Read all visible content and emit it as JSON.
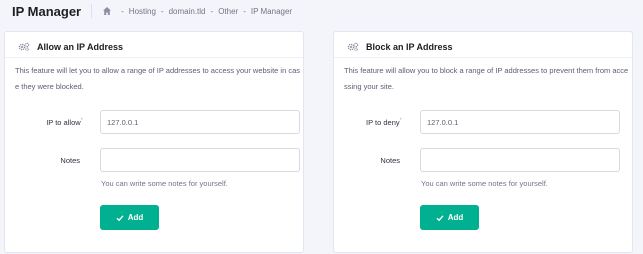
{
  "header": {
    "title": "IP Manager",
    "breadcrumb": [
      "Hosting",
      "domain.tld",
      "Other",
      "IP Manager"
    ]
  },
  "allow_card": {
    "title": "Allow an IP Address",
    "description": "This feature will let you to allow a range of IP addresses to access your website in case they were blocked.",
    "ip_label": "IP to allow",
    "ip_value": "127.0.0.1",
    "notes_label": "Notes",
    "notes_value": "",
    "notes_help": "You can write some notes for yourself.",
    "button_label": "Add"
  },
  "block_card": {
    "title": "Block an IP Address",
    "description": "This feature will allow you to block a range of IP addresses to prevent them from accessing your site.",
    "ip_label": "IP to deny",
    "ip_value": "127.0.0.1",
    "notes_label": "Notes",
    "notes_value": "",
    "notes_help": "You can write some notes for yourself.",
    "button_label": "Add"
  },
  "colors": {
    "accent": "#00b090",
    "title": "#1d1e20",
    "background": "#f4f5fb"
  },
  "icons": {
    "home": "home-icon",
    "settings": "gears-icon",
    "check": "check-icon"
  }
}
